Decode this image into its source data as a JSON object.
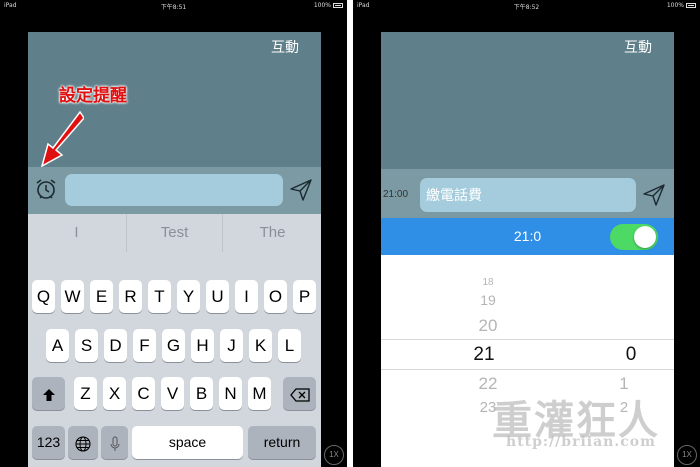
{
  "left": {
    "status": {
      "device": "iPad",
      "time": "下午8:51",
      "battery": "100%"
    },
    "nav_title": "互動",
    "annotation": "設定提醒",
    "input_placeholder": "",
    "suggestions": [
      "I",
      "Test",
      "The"
    ],
    "keyboard": {
      "row1": [
        "Q",
        "W",
        "E",
        "R",
        "T",
        "Y",
        "U",
        "I",
        "O",
        "P"
      ],
      "row2": [
        "A",
        "S",
        "D",
        "F",
        "G",
        "H",
        "J",
        "K",
        "L"
      ],
      "row3": [
        "Z",
        "X",
        "C",
        "V",
        "B",
        "N",
        "M"
      ],
      "numbers_key": "123",
      "space_key": "space",
      "return_key": "return"
    },
    "zoom": "1X"
  },
  "right": {
    "status": {
      "device": "iPad",
      "time": "下午8:52",
      "battery": "100%"
    },
    "nav_title": "互動",
    "reminder_time": "21:00",
    "message_text": "繳電話費",
    "bar_time": "21:0",
    "toggle_on": true,
    "picker": {
      "hours": [
        "18",
        "19",
        "20",
        "21",
        "22",
        "23"
      ],
      "selected_hour": "21",
      "minutes": [
        "0",
        "1",
        "2"
      ],
      "selected_minute": "0"
    },
    "zoom": "1X"
  },
  "watermark": {
    "text": "重灌狂人",
    "url": "http://briian.com"
  },
  "colors": {
    "teal": "#5f7f8a",
    "input_bar": "#7b9aa3",
    "input_field": "#a4ccdc",
    "blue_bar": "#2f8ee6",
    "toggle_on": "#4cd964",
    "annotation": "#e01010"
  }
}
